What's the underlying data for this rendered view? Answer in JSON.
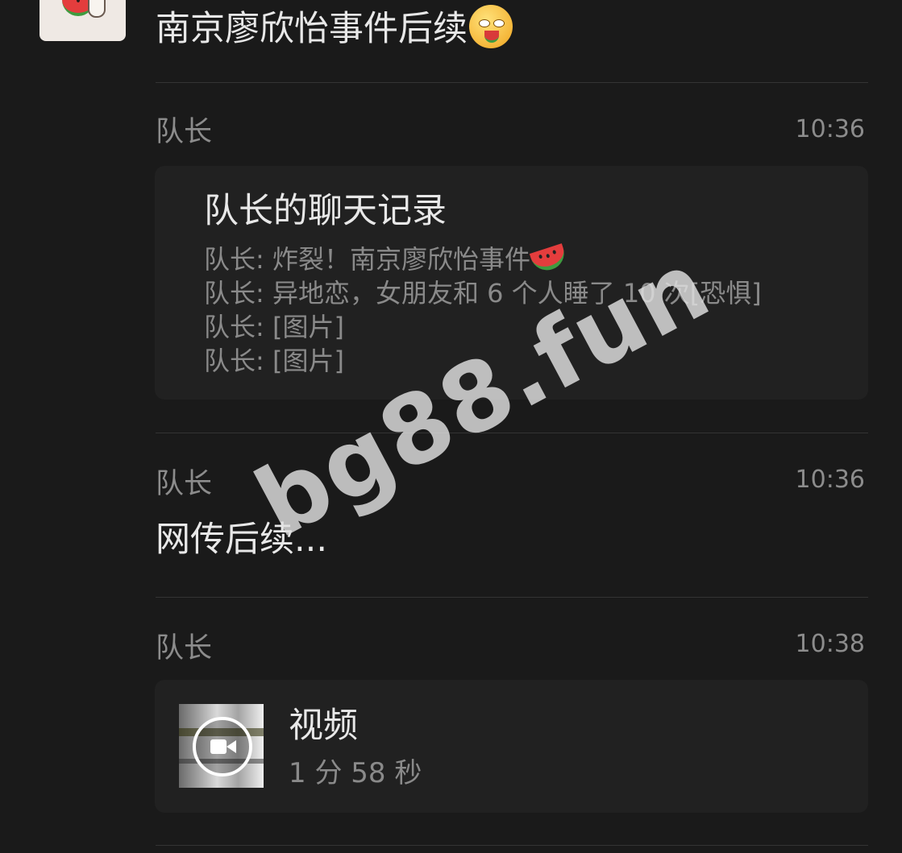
{
  "header": {
    "title": "南京廖欣怡事件后续",
    "avatar_icon": "watermelon-avatar",
    "title_emoji_icon": "face-with-watermelon-icon"
  },
  "messages": [
    {
      "sender": "队长",
      "time": "10:36",
      "type": "chat-record",
      "record": {
        "title": "队长的聊天记录",
        "lines": [
          "队长: 炸裂！南京廖欣怡事件",
          "队长: 异地恋，女朋友和 6 个人睡了 10 次[恐惧]",
          "队长: [图片]",
          "队长: [图片]"
        ],
        "line1_emoji_icon": "watermelon-icon"
      }
    },
    {
      "sender": "队长",
      "time": "10:36",
      "type": "text",
      "text": "网传后续..."
    },
    {
      "sender": "队长",
      "time": "10:38",
      "type": "video",
      "video": {
        "label": "视频",
        "duration": "1 分 58 秒",
        "icon": "video-camera-icon"
      }
    }
  ],
  "watermark": "bg88.fun"
}
